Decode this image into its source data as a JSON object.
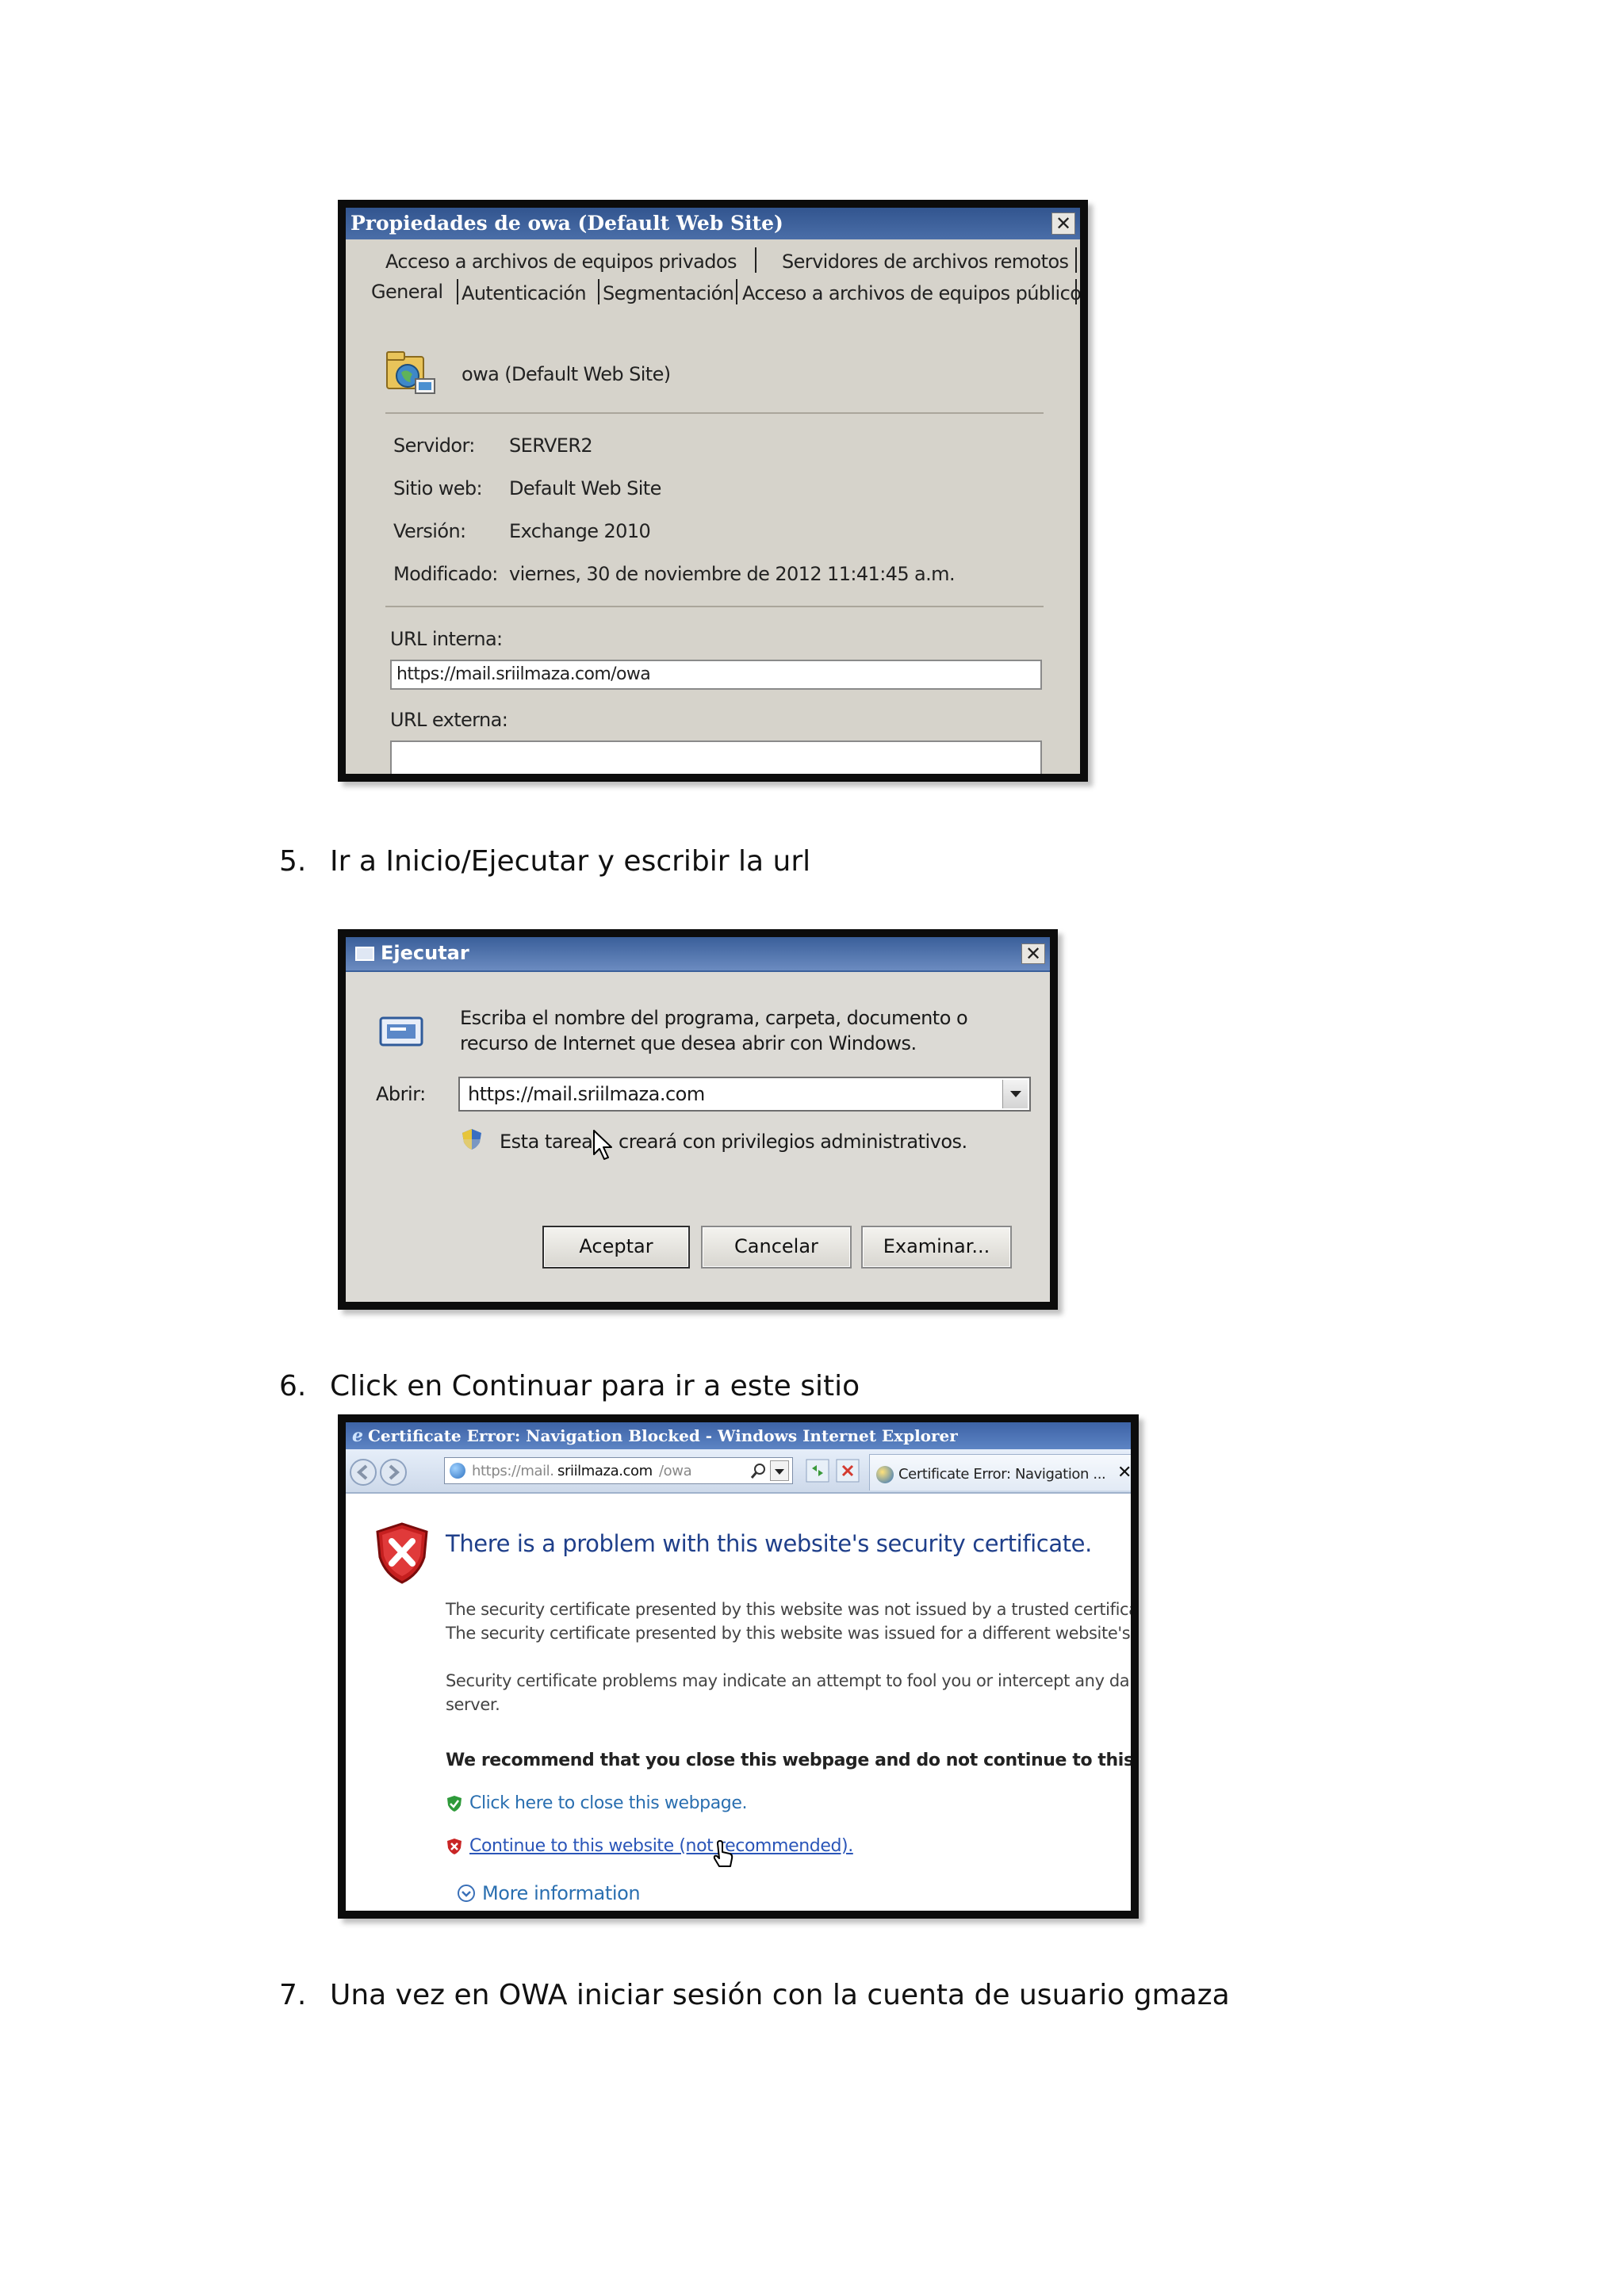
{
  "dialog_properties": {
    "title": "Propiedades de owa (Default Web Site)",
    "close": "✕",
    "tabs_row1": [
      "Acceso a archivos de equipos privados",
      "Servidores de archivos remotos"
    ],
    "tabs_row2": [
      "General",
      "Autenticación",
      "Segmentación",
      "Acceso a archivos de equipos públicos"
    ],
    "site_name": "owa (Default Web Site)",
    "fields": [
      {
        "label": "Servidor:",
        "value": "SERVER2"
      },
      {
        "label": "Sitio web:",
        "value": "Default Web Site"
      },
      {
        "label": "Versión:",
        "value": "Exchange 2010"
      },
      {
        "label": "Modificado:",
        "value": "viernes, 30 de noviembre de 2012 11:41:45 a.m."
      }
    ],
    "internal_url_label": "URL interna:",
    "internal_url_value": "https://mail.sriilmaza.com/owa",
    "external_url_label": "URL externa:",
    "external_url_value": ""
  },
  "step5": {
    "num": "5.",
    "text": "Ir a Inicio/Ejecutar y escribir la url"
  },
  "dialog_run": {
    "title": "Ejecutar",
    "close": "✕",
    "desc_line1": "Escriba el nombre del programa, carpeta, documento o",
    "desc_line2": "recurso de Internet que desea abrir con Windows.",
    "open_label": "Abrir:",
    "open_value": "https://mail.sriilmaza.com",
    "admin_note_a": "Esta tarea",
    "admin_note_b": "creará con privilegios administrativos.",
    "ok": "Aceptar",
    "cancel": "Cancelar",
    "browse": "Examinar..."
  },
  "step6": {
    "num": "6.",
    "text": "Click en Continuar para ir a este sitio"
  },
  "ie_window": {
    "title": "Certificate Error: Navigation Blocked - Windows Internet Explorer",
    "address_prefix": "https://mail.",
    "address_host": "sriilmaza.com",
    "address_path": "/owa",
    "tab_label": "Certificate Error: Navigation ...",
    "tab_close": "✕",
    "heading": "There is a problem with this website's security certificate.",
    "para1_line1": "The security certificate presented by this website was not issued by a trusted certifica",
    "para1_line2": "The security certificate presented by this website was issued for a different website's",
    "para2_line1": "Security certificate problems may indicate an attempt to fool you or intercept any da",
    "para2_line2": "server.",
    "recommend": "We recommend that you close this webpage and do not continue to this web",
    "close_link": "Click here to close this webpage.",
    "continue_link": "Continue to this website (not recommended).",
    "more_info": "More information"
  },
  "step7": {
    "num": "7.",
    "text": "Una vez en OWA iniciar sesión con la cuenta de usuario gmaza"
  }
}
